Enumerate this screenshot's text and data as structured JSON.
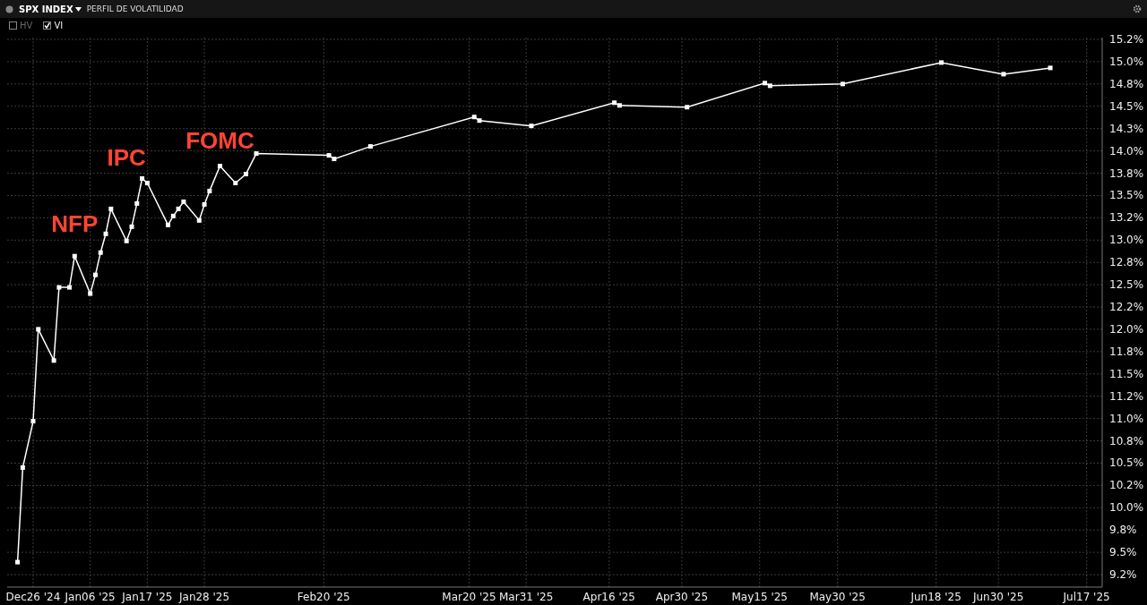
{
  "header": {
    "ticker": "SPX INDEX",
    "title": "PERFIL DE VOLATILIDAD"
  },
  "toggles": [
    {
      "label": "HV",
      "checked": false
    },
    {
      "label": "VI",
      "checked": true
    }
  ],
  "chart_data": {
    "type": "line",
    "xlim": [
      "2024-12-21",
      "2025-07-20"
    ],
    "ylim": [
      9.11,
      15.27
    ],
    "x": [
      "2024-12-23",
      "2024-12-24",
      "2024-12-26",
      "2024-12-27",
      "2024-12-30",
      "2024-12-31",
      "2025-01-02",
      "2025-01-03",
      "2025-01-06",
      "2025-01-07",
      "2025-01-08",
      "2025-01-09",
      "2025-01-10",
      "2025-01-13",
      "2025-01-14",
      "2025-01-15",
      "2025-01-16",
      "2025-01-17",
      "2025-01-21",
      "2025-01-22",
      "2025-01-23",
      "2025-01-24",
      "2025-01-27",
      "2025-01-28",
      "2025-01-29",
      "2025-01-31",
      "2025-02-03",
      "2025-02-05",
      "2025-02-07",
      "2025-02-21",
      "2025-02-22",
      "2025-03-01",
      "2025-03-21",
      "2025-03-22",
      "2025-04-01",
      "2025-04-17",
      "2025-04-18",
      "2025-05-01",
      "2025-05-16",
      "2025-05-17",
      "2025-05-31",
      "2025-06-19",
      "2025-07-01",
      "2025-07-10"
    ],
    "grid": true,
    "series": [
      {
        "color": "#ffffff",
        "marker": "square",
        "values": [
          9.39,
          10.45,
          10.97,
          12.0,
          11.65,
          12.47,
          12.47,
          12.82,
          12.4,
          12.61,
          12.86,
          13.07,
          13.35,
          12.99,
          13.15,
          13.41,
          13.69,
          13.64,
          13.17,
          13.27,
          13.35,
          13.43,
          13.22,
          13.4,
          13.55,
          13.83,
          13.64,
          13.74,
          13.97,
          13.95,
          13.91,
          14.05,
          14.38,
          14.34,
          14.28,
          14.54,
          14.51,
          14.49,
          14.76,
          14.73,
          14.75,
          14.99,
          14.86,
          14.93
        ]
      }
    ],
    "xticks": [
      {
        "value": "2024-12-26",
        "label": "Dec26 '24"
      },
      {
        "value": "2025-01-06",
        "label": "Jan06 '25"
      },
      {
        "value": "2025-01-17",
        "label": "Jan17 '25"
      },
      {
        "value": "2025-01-28",
        "label": "Jan28 '25"
      },
      {
        "value": "2025-02-20",
        "label": "Feb20 '25"
      },
      {
        "value": "2025-03-20",
        "label": "Mar20 '25"
      },
      {
        "value": "2025-03-31",
        "label": "Mar31 '25"
      },
      {
        "value": "2025-04-16",
        "label": "Apr16 '25"
      },
      {
        "value": "2025-04-30",
        "label": "Apr30 '25"
      },
      {
        "value": "2025-05-15",
        "label": "May15 '25"
      },
      {
        "value": "2025-05-30",
        "label": "May30 '25"
      },
      {
        "value": "2025-06-18",
        "label": "Jun18 '25"
      },
      {
        "value": "2025-06-30",
        "label": "Jun30 '25"
      },
      {
        "value": "2025-07-17",
        "label": "Jul17 '25"
      }
    ],
    "yticks": [
      {
        "value": 15.25,
        "label": "15.2%"
      },
      {
        "value": 15.0,
        "label": "15.0%"
      },
      {
        "value": 14.75,
        "label": "14.8%"
      },
      {
        "value": 14.5,
        "label": "14.5%"
      },
      {
        "value": 14.25,
        "label": "14.3%"
      },
      {
        "value": 14.0,
        "label": "14.0%"
      },
      {
        "value": 13.75,
        "label": "13.8%"
      },
      {
        "value": 13.5,
        "label": "13.5%"
      },
      {
        "value": 13.25,
        "label": "13.2%"
      },
      {
        "value": 13.0,
        "label": "13.0%"
      },
      {
        "value": 12.75,
        "label": "12.8%"
      },
      {
        "value": 12.5,
        "label": "12.5%"
      },
      {
        "value": 12.25,
        "label": "12.2%"
      },
      {
        "value": 12.0,
        "label": "12.0%"
      },
      {
        "value": 11.75,
        "label": "11.8%"
      },
      {
        "value": 11.5,
        "label": "11.5%"
      },
      {
        "value": 11.25,
        "label": "11.2%"
      },
      {
        "value": 11.0,
        "label": "11.0%"
      },
      {
        "value": 10.75,
        "label": "10.8%"
      },
      {
        "value": 10.5,
        "label": "10.5%"
      },
      {
        "value": 10.25,
        "label": "10.2%"
      },
      {
        "value": 10.0,
        "label": "10.0%"
      },
      {
        "value": 9.75,
        "label": "9.8%"
      },
      {
        "value": 9.5,
        "label": "9.5%"
      },
      {
        "value": 9.25,
        "label": "9.2%"
      }
    ],
    "annotations": [
      "NFP",
      "IPC",
      "FOMC"
    ]
  }
}
